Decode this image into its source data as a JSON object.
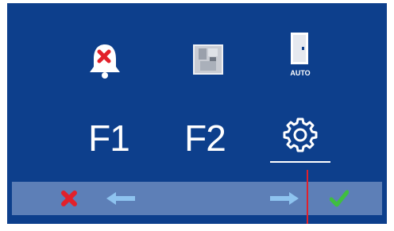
{
  "colors": {
    "panel_bg": "#0d3f8c",
    "bar_bg": "#5d7fb7",
    "accent_red": "#e2202a",
    "check_green": "#3fbf3f"
  },
  "top_icons": [
    {
      "icon": "bell-mute-icon"
    },
    {
      "icon": "door-panel-icon"
    },
    {
      "icon": "auto-door-icon",
      "label": "AUTO"
    }
  ],
  "function_keys": {
    "f1": "F1",
    "f2": "F2"
  },
  "settings": {
    "icon": "gear-icon"
  },
  "bottom_bar": {
    "cancel": "close-icon",
    "left": "arrow-left-icon",
    "right": "arrow-right-icon",
    "confirm": "check-icon"
  }
}
